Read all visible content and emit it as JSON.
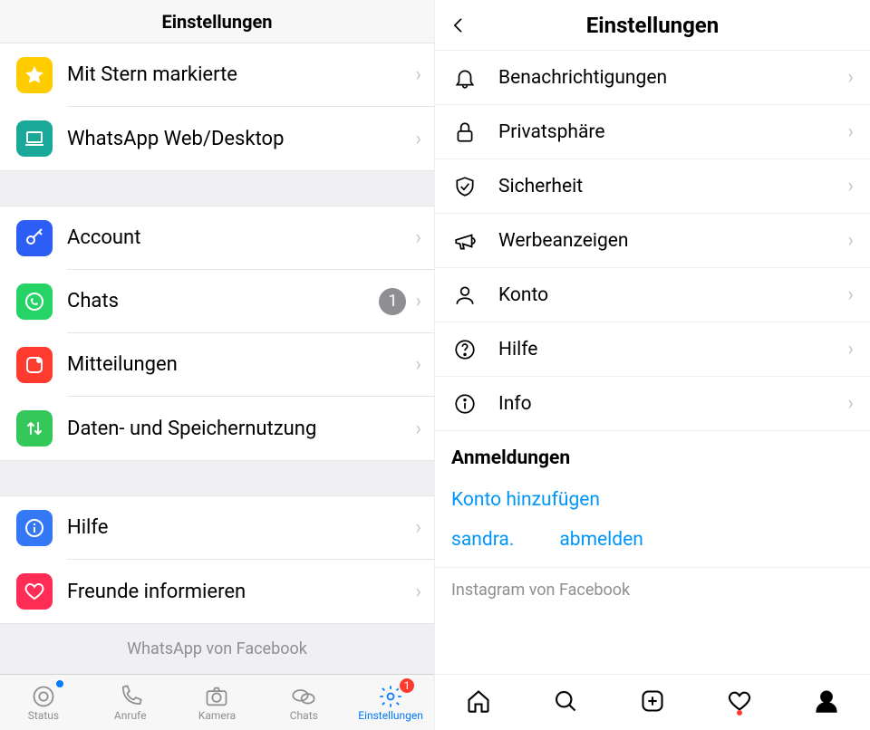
{
  "whatsapp": {
    "title": "Einstellungen",
    "groups": [
      [
        {
          "id": "starred",
          "label": "Mit Stern markierte",
          "color": "#ffcc00",
          "glyph": "star"
        },
        {
          "id": "web",
          "label": "WhatsApp Web/Desktop",
          "color": "#1aa898",
          "glyph": "laptop"
        }
      ],
      [
        {
          "id": "account",
          "label": "Account",
          "color": "#2c5ef6",
          "glyph": "key"
        },
        {
          "id": "chats",
          "label": "Chats",
          "color": "#25d366",
          "glyph": "whatsapp",
          "badge": "1"
        },
        {
          "id": "notifications",
          "label": "Mitteilungen",
          "color": "#ff3b30",
          "glyph": "app-badge"
        },
        {
          "id": "data",
          "label": "Daten- und Speichernutzung",
          "color": "#34c759",
          "glyph": "updown"
        }
      ],
      [
        {
          "id": "help",
          "label": "Hilfe",
          "color": "#3478f6",
          "glyph": "info"
        },
        {
          "id": "tellfriend",
          "label": "Freunde informieren",
          "color": "#ff2d55",
          "glyph": "heart"
        }
      ]
    ],
    "footer": "WhatsApp von Facebook",
    "tabs": [
      {
        "id": "status",
        "label": "Status",
        "glyph": "status",
        "dot": true
      },
      {
        "id": "calls",
        "label": "Anrufe",
        "glyph": "phone"
      },
      {
        "id": "camera",
        "label": "Kamera",
        "glyph": "camera"
      },
      {
        "id": "chatstab",
        "label": "Chats",
        "glyph": "chats"
      },
      {
        "id": "settings",
        "label": "Einstellungen",
        "glyph": "gear",
        "active": true,
        "badge": "1"
      }
    ]
  },
  "instagram": {
    "title": "Einstellungen",
    "items": [
      {
        "id": "notifications",
        "label": "Benachrichtigungen",
        "glyph": "bell"
      },
      {
        "id": "privacy",
        "label": "Privatsphäre",
        "glyph": "lock"
      },
      {
        "id": "security",
        "label": "Sicherheit",
        "glyph": "shield"
      },
      {
        "id": "ads",
        "label": "Werbeanzeigen",
        "glyph": "megaphone"
      },
      {
        "id": "account",
        "label": "Konto",
        "glyph": "user"
      },
      {
        "id": "help",
        "label": "Hilfe",
        "glyph": "question"
      },
      {
        "id": "about",
        "label": "Info",
        "glyph": "info"
      }
    ],
    "logins_title": "Anmeldungen",
    "add_account": "Konto hinzufügen",
    "username": "sandra.",
    "logout": "abmelden",
    "footer": "Instagram von Facebook",
    "tabs": [
      {
        "id": "home",
        "glyph": "home"
      },
      {
        "id": "search",
        "glyph": "search"
      },
      {
        "id": "add",
        "glyph": "plus"
      },
      {
        "id": "activity",
        "glyph": "heart",
        "dot": true
      },
      {
        "id": "profile",
        "glyph": "profile",
        "active": true
      }
    ]
  }
}
